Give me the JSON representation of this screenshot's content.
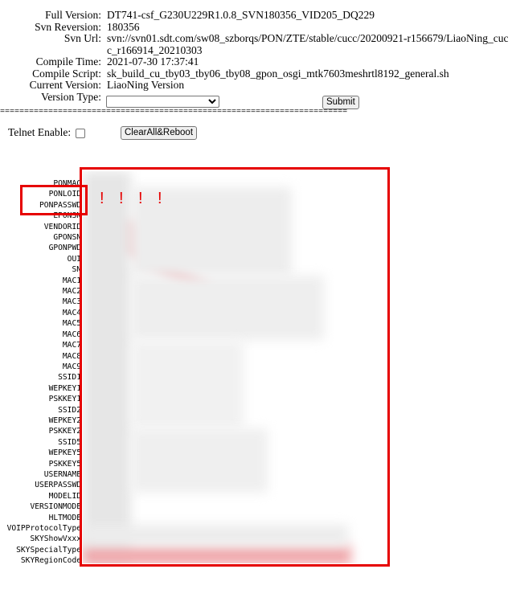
{
  "info": {
    "full_version": {
      "label": "Full Version:",
      "value": "DT741-csf_G230U229R1.0.8_SVN180356_VID205_DQ229"
    },
    "svn_revision": {
      "label": "Svn Reversion:",
      "value": "180356"
    },
    "svn_url": {
      "label": "Svn Url:",
      "value": "svn://svn01.sdt.com/sw08_szborqs/PON/ZTE/stable/cucc/20200921-r156679/LiaoNing_cucc_r166914_20210303"
    },
    "compile_time": {
      "label": "Compile Time:",
      "value": "2021-07-30 17:37:41"
    },
    "compile_script": {
      "label": "Compile Script:",
      "value": "sk_build_cu_tby03_tby06_tby08_gpon_osgi_mtk7603meshrtl8192_general.sh"
    },
    "current_version": {
      "label": "Current Version:",
      "value": "LiaoNing Version"
    },
    "version_type": {
      "label": "Version Type:",
      "value": ""
    }
  },
  "submit_label": "Submit",
  "separator": "==========================================================================",
  "telnet_label": "Telnet Enable:",
  "telnet_checked": false,
  "clear_reboot_label": "ClearAll&Reboot",
  "params": [
    "PONMAC",
    "PONLOID",
    "PONPASSWD",
    "EPONSN",
    "VENDORID",
    "GPONSN",
    "GPONPWD",
    "OUI",
    "SN",
    "MAC1",
    "MAC2",
    "MAC3",
    "MAC4",
    "MAC5",
    "MAC6",
    "MAC7",
    "MAC8",
    "MAC9",
    "SSID1",
    "WEPKEY1",
    "PSKKEY1",
    "SSID2",
    "WEPKEY2",
    "PSKKEY2",
    "SSID5",
    "WEPKEY5",
    "PSKKEY5",
    "USERNAME",
    "USERPASSWD",
    "MODELID",
    "VERSIONMODE",
    "HLTMODE",
    "VOIPProtocolType",
    "SKYShowVxxx",
    "SKYSpecialType",
    "SKYRegionCode"
  ],
  "annotation_marks": [
    "!",
    "!",
    "!",
    "!"
  ],
  "colors": {
    "annotation_red": "#e60000"
  }
}
